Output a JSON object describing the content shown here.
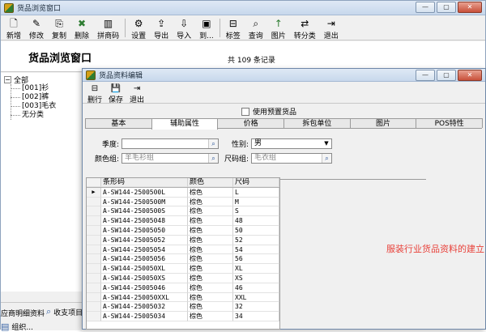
{
  "bg_window": {
    "title": "货品浏览窗口",
    "toolbar": [
      {
        "label": "新增",
        "icon": "new-doc-icon",
        "glyph": "🗋"
      },
      {
        "label": "修改",
        "icon": "edit-icon",
        "glyph": "✎"
      },
      {
        "label": "复制",
        "icon": "copy-icon",
        "glyph": "⎘"
      },
      {
        "label": "删除",
        "icon": "delete-icon",
        "glyph": "✖"
      },
      {
        "label": "拼商码",
        "icon": "barcode-icon",
        "glyph": "▥"
      },
      {
        "label": "设置",
        "icon": "settings-icon",
        "glyph": "⚙"
      },
      {
        "label": "导出",
        "icon": "export-icon",
        "glyph": "⇪"
      },
      {
        "label": "导入",
        "icon": "import-icon",
        "glyph": "⇩"
      },
      {
        "label": "到...",
        "icon": "goto-icon",
        "glyph": "▣"
      },
      {
        "label": "标签",
        "icon": "label-icon",
        "glyph": "⊟"
      },
      {
        "label": "查询",
        "icon": "query-icon",
        "glyph": "⌕"
      },
      {
        "label": "图片",
        "icon": "picture-icon",
        "glyph": "↑"
      },
      {
        "label": "转分类",
        "icon": "reclassify-icon",
        "glyph": "⇄"
      },
      {
        "label": "退出",
        "icon": "exit-icon",
        "glyph": "⇥"
      }
    ],
    "header_title": "货品浏览窗口",
    "record_count": "共 109 条记录",
    "tree": {
      "root": "全部",
      "children": [
        "[001]衫",
        "[002]裤",
        "[003]毛衣",
        "无分类"
      ]
    },
    "bottom_items": [
      {
        "label": "应商明细资料",
        "icon": "list-icon"
      },
      {
        "label": "收支项目",
        "icon": "search-icon"
      },
      {
        "label": "组织...",
        "icon": "list-icon"
      },
      {
        "label": "...",
        "icon": "search-icon"
      }
    ]
  },
  "dialog": {
    "title": "货品资料编辑",
    "toolbar": [
      {
        "label": "删行",
        "icon": "delete-row-icon",
        "glyph": "⊟"
      },
      {
        "label": "保存",
        "icon": "save-icon",
        "glyph": "💾"
      },
      {
        "label": "退出",
        "icon": "exit-icon",
        "glyph": "⇥"
      }
    ],
    "preset_label": "使用预置货品",
    "tabs": [
      "基本",
      "辅助属性",
      "价格",
      "拆包单位",
      "图片",
      "POS特性"
    ],
    "active_tab": 1,
    "fields": {
      "season_label": "季度:",
      "season_value": "",
      "gender_label": "性别:",
      "gender_value": "男",
      "color_group_label": "颜色组:",
      "color_group_value": "羊毛衫组",
      "size_group_label": "尺码组:",
      "size_group_value": "毛衣组"
    },
    "grid": {
      "headers": [
        "条形码",
        "颜色",
        "尺码"
      ],
      "rows": [
        [
          "A-SW144-2500500L",
          "棕色",
          "L"
        ],
        [
          "A-SW144-2500500M",
          "棕色",
          "M"
        ],
        [
          "A-SW144-2500500S",
          "棕色",
          "S"
        ],
        [
          "A-SW144-25005048",
          "棕色",
          "48"
        ],
        [
          "A-SW144-25005050",
          "棕色",
          "50"
        ],
        [
          "A-SW144-25005052",
          "棕色",
          "52"
        ],
        [
          "A-SW144-25005054",
          "棕色",
          "54"
        ],
        [
          "A-SW144-25005056",
          "棕色",
          "56"
        ],
        [
          "A-SW144-250050XL",
          "棕色",
          "XL"
        ],
        [
          "A-SW144-250050XS",
          "棕色",
          "XS"
        ],
        [
          "A-SW144-25005046",
          "棕色",
          "46"
        ],
        [
          "A-SW144-250050XXL",
          "棕色",
          "XXL"
        ],
        [
          "A-SW144-25005032",
          "棕色",
          "32"
        ],
        [
          "A-SW144-25005034",
          "棕色",
          "34"
        ]
      ]
    },
    "promo_text": "服装行业货品资料的建立"
  },
  "window_buttons": {
    "minimize": "—",
    "maximize": "▢",
    "close": "✕"
  },
  "colors": {
    "promo": "#e8413a",
    "titlebar": "#c7d8ec"
  }
}
